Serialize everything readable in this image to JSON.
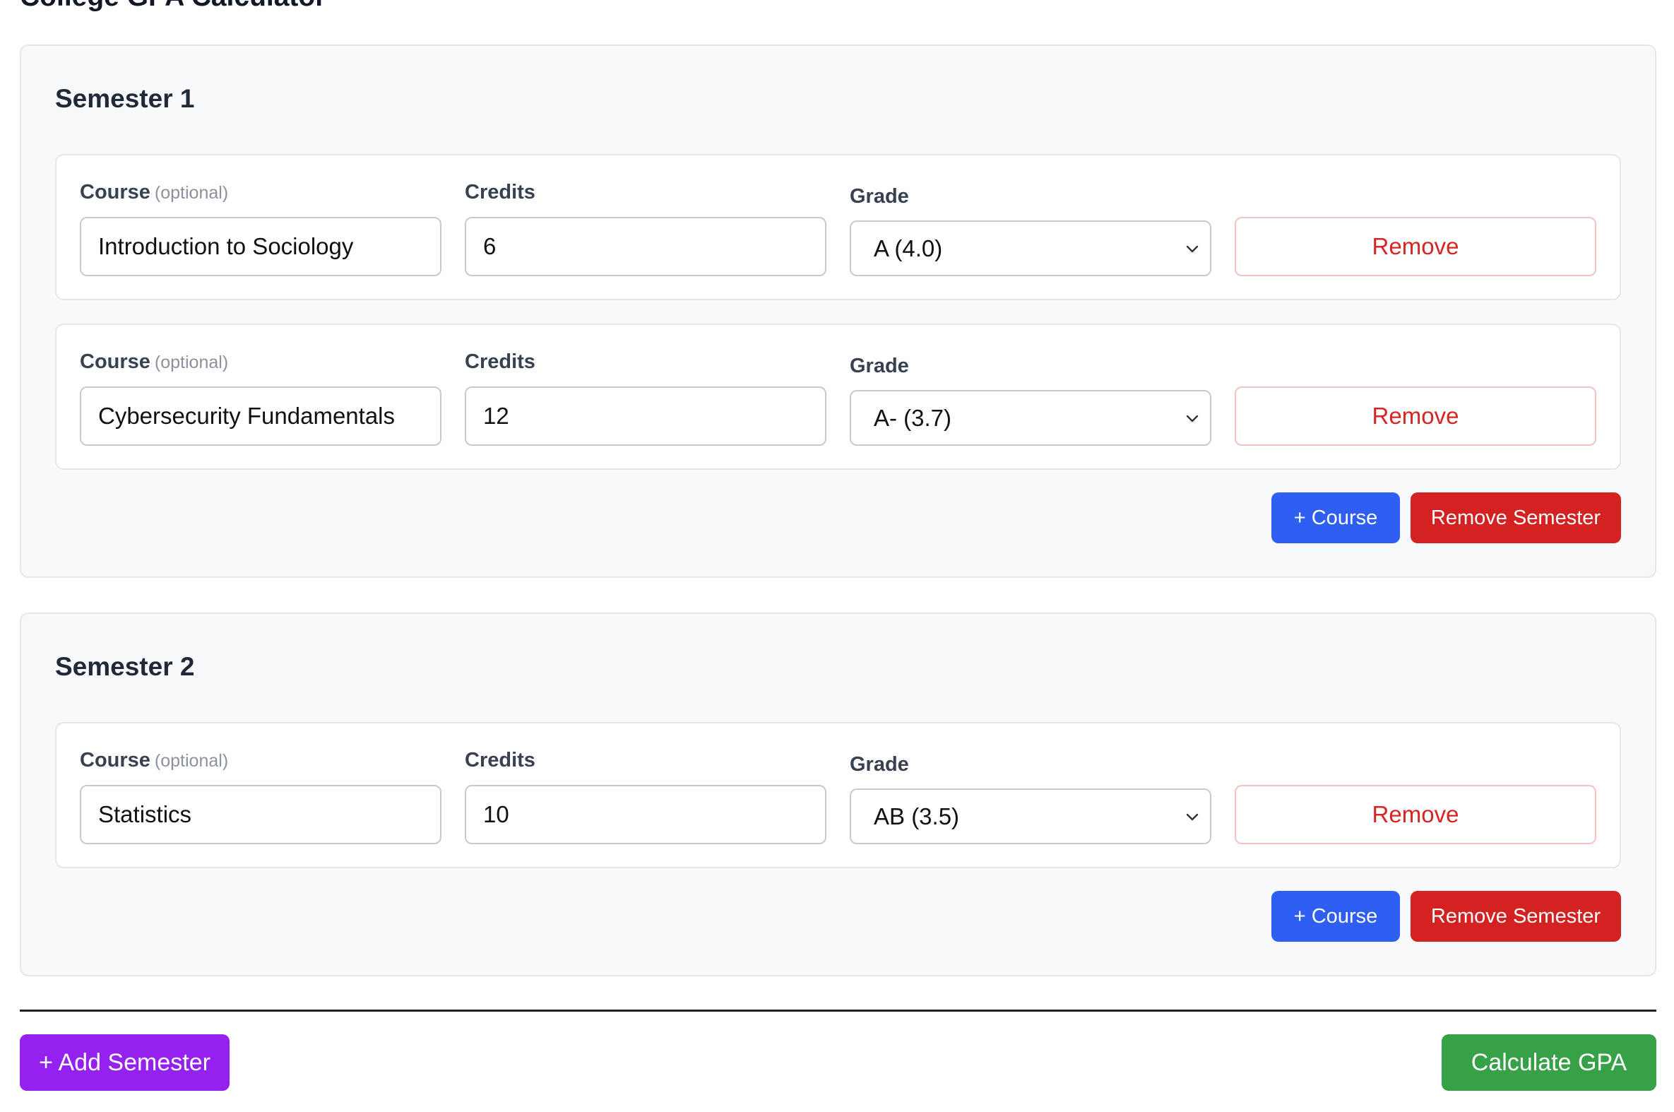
{
  "app": {
    "title": "College GPA Calculator"
  },
  "labels": {
    "course": "Course",
    "optional": "(optional)",
    "credits": "Credits",
    "grade": "Grade",
    "remove": "Remove",
    "add_course": "+ Course",
    "remove_semester": "Remove Semester"
  },
  "semesters": [
    {
      "title": "Semester 1",
      "courses": [
        {
          "name": "Introduction to Sociology",
          "credits": "6",
          "grade": "A (4.0)"
        },
        {
          "name": "Cybersecurity Fundamentals",
          "credits": "12",
          "grade": "A- (3.7)"
        }
      ]
    },
    {
      "title": "Semester 2",
      "courses": [
        {
          "name": "Statistics",
          "credits": "10",
          "grade": "AB (3.5)"
        }
      ]
    }
  ],
  "footer": {
    "add_semester": "+ Add Semester",
    "calculate": "Calculate GPA"
  },
  "colors": {
    "course_button": "#2f5ef2",
    "remove_semester_button": "#d42222",
    "remove_text": "#d92424",
    "add_semester_button": "#9421f0",
    "calculate_button": "#37a147"
  },
  "icons": {
    "select_arrow": "chevron-down-icon"
  }
}
